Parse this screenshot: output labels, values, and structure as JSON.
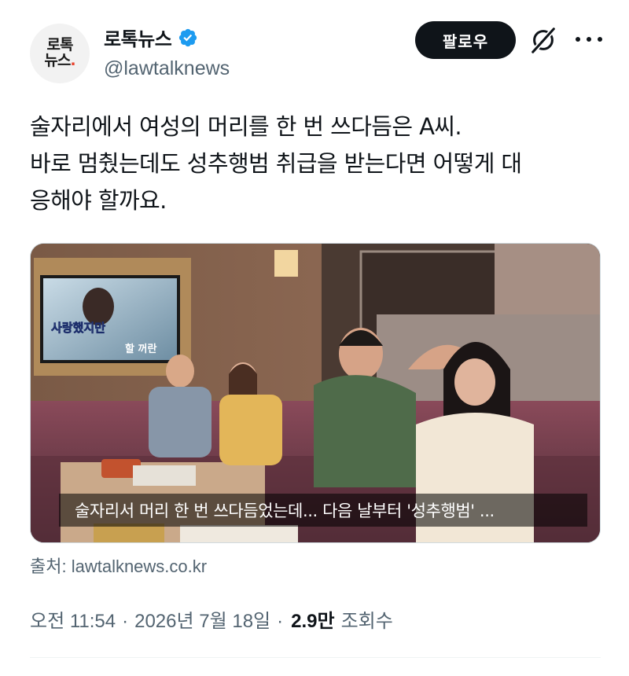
{
  "author": {
    "avatar_line1": "로톡",
    "avatar_line2": "뉴스",
    "avatar_dot": ".",
    "display_name": "로톡뉴스",
    "handle": "@lawtalknews",
    "verified": true
  },
  "actions": {
    "follow_label": "팔로우",
    "grok_icon": "grok-icon",
    "more_icon": "more-icon"
  },
  "tweet": {
    "text_lines": [
      "술자리에서 여성의 머리를 한 번 쓰다듬은 A씨.",
      "바로 멈췄는데도 성추행범 취급을 받는다면 어떻게 대",
      "응해야 할까요."
    ],
    "media_caption": "술자리서 머리 한 번 쓰다듬었는데... 다음 날부터 '성추행범' ...",
    "karaoke_subtitle_1": "사랑했지만",
    "karaoke_subtitle_2": "할 꺼란",
    "source": "출처: lawtalknews.co.kr"
  },
  "meta": {
    "time": "오전 11:54",
    "date": "2026년 7월 18일",
    "views_count": "2.9만",
    "views_label": "조회수"
  },
  "colors": {
    "text": "#0f1419",
    "secondary": "#536471",
    "verified_blue": "#1d9bf0",
    "button_bg": "#0f1419"
  }
}
